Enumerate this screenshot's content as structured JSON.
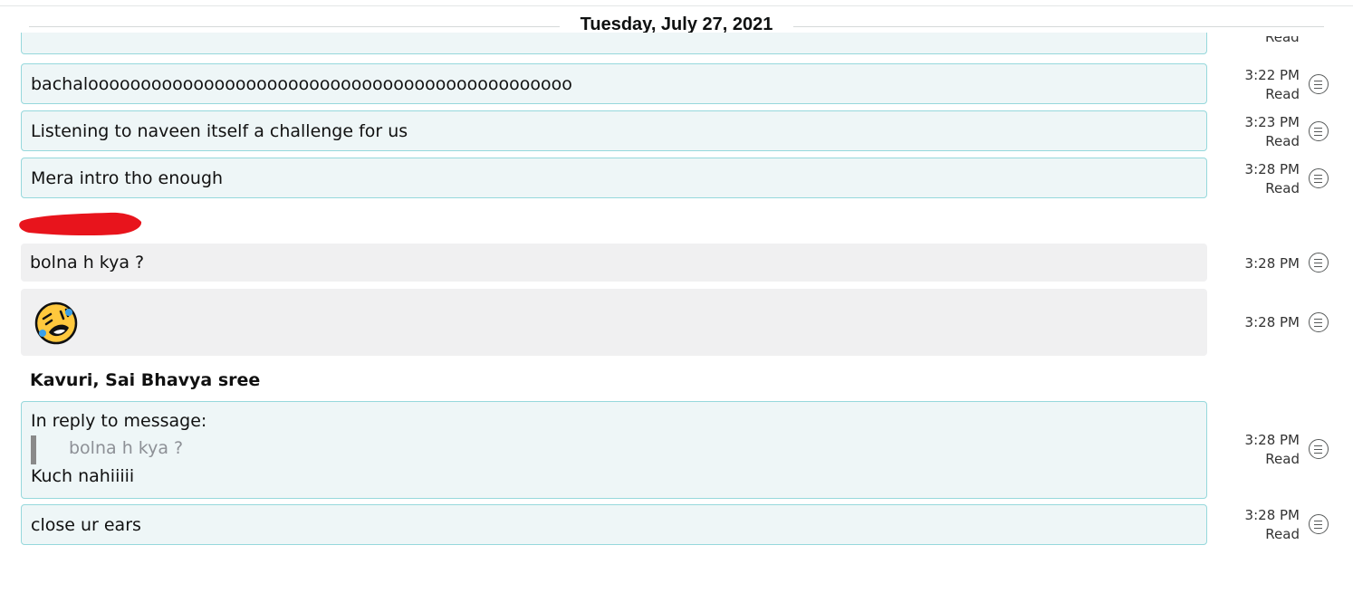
{
  "header": {
    "date": "Tuesday, July 27, 2021"
  },
  "partial_status": "Read",
  "messages": [
    {
      "text": "bachaloooooooooooooooooooooooooooooooooooooooooooooo",
      "time": "3:22 PM",
      "status": "Read"
    },
    {
      "text": "Listening to naveen itself a challenge for us",
      "time": "3:23 PM",
      "status": "Read"
    },
    {
      "text": "Mera intro tho enough",
      "time": "3:28 PM",
      "status": "Read"
    },
    {
      "text": "bolna h kya ?",
      "time": "3:28 PM"
    },
    {
      "emoji": "rolling-on-the-floor-laughing",
      "time": "3:28 PM"
    },
    {
      "sender": "Kavuri, Sai Bhavya sree"
    },
    {
      "reply_label": "In reply to message:",
      "quoted": "bolna h kya ?",
      "text": "Kuch nahiiiii",
      "time": "3:28 PM",
      "status": "Read"
    },
    {
      "text": "close ur ears",
      "time": "3:28 PM",
      "status": "Read"
    }
  ],
  "icons": {
    "message_menu": "message-options-icon"
  },
  "colors": {
    "sent_bg": "#eef6f7",
    "sent_border": "#96d8dc",
    "received_bg": "#f0f0f1",
    "redaction": "#e8141c"
  }
}
